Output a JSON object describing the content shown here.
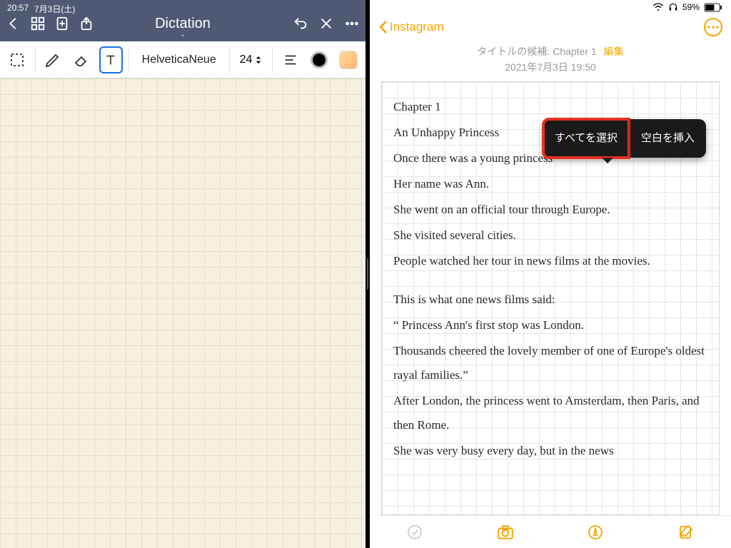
{
  "status_left": {
    "time": "20:57",
    "date": "7月3日(土)"
  },
  "status_right": {
    "battery_pct": "59%"
  },
  "left_app": {
    "title": "Dictation",
    "font_name": "HelveticaNeue",
    "font_size": "24"
  },
  "right_app": {
    "back_label": "Instagram",
    "title_prefix": "タイトルの候補: ",
    "title_value": "Chapter 1",
    "edit_label": "編集",
    "timestamp": "2021年7月3日 19:50",
    "context_menu": {
      "select_all": "すべてを選択",
      "insert_space": "空白を挿入"
    },
    "note_lines": [
      "Chapter 1",
      "An Unhappy Princess",
      "Once there was a young princess",
      "Her name was Ann.",
      "She went on an official tour through Europe.",
      "She visited several cities.",
      "People watched her tour in news films at the movies.",
      "",
      "This is what one news films said:",
      "“ Princess Ann's first stop was London.",
      "Thousands cheered the lovely member of one of Europe's oldest rayal families.”",
      "After London, the princess went to Amsterdam, then Paris, and then Rome.",
      "She was very busy every day, but in the news"
    ]
  }
}
